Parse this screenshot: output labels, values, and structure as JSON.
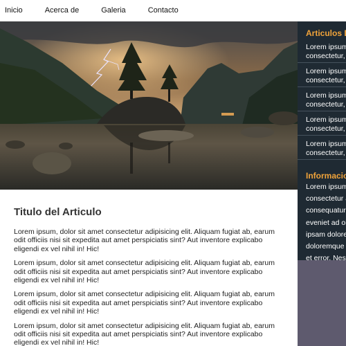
{
  "nav": {
    "items": [
      "Inicio",
      "Acerca de",
      "Galeria",
      "Contacto"
    ]
  },
  "hero": {
    "icon": "landscape-photo"
  },
  "article": {
    "title": "Titulo del Articulo",
    "paragraphs": [
      "Lorem ipsum, dolor sit amet consectetur adipisicing elit. Aliquam fugiat ab, earum odit officiis nisi sit expedita aut amet perspiciatis sint? Aut inventore explicabo eligendi ex vel nihil in! Hic!",
      "Lorem ipsum, dolor sit amet consectetur adipisicing elit. Aliquam fugiat ab, earum odit officiis nisi sit expedita aut amet perspiciatis sint? Aut inventore explicabo eligendi ex vel nihil in! Hic!",
      "Lorem ipsum, dolor sit amet consectetur adipisicing elit. Aliquam fugiat ab, earum odit officiis nisi sit expedita aut amet perspiciatis sint? Aut inventore explicabo eligendi ex vel nihil in! Hic!",
      "Lorem ipsum, dolor sit amet consectetur adipisicing elit. Aliquam fugiat ab, earum odit officiis nisi sit expedita aut amet perspiciatis sint? Aut inventore explicabo eligendi ex vel nihil in! Hic!"
    ]
  },
  "sidebar": {
    "articles_heading": "Articulos D",
    "articles": [
      {
        "line1": "Lorem ipsum",
        "line2": "consectetur, a"
      },
      {
        "line1": "Lorem ipsum",
        "line2": "consectetur, a"
      },
      {
        "line1": "Lorem ipsum",
        "line2": "consectetur, a"
      },
      {
        "line1": "Lorem ipsum",
        "line2": "consectetur, a"
      },
      {
        "line1": "Lorem ipsum",
        "line2": "consectetur, a"
      }
    ],
    "info_heading": "Informacio",
    "info_lines": [
      "Lorem ipsum",
      "consectetur a",
      "consequatur",
      "eveniet ad ob",
      "ipsam dolore",
      "doloremque s",
      "et error. Nesc"
    ]
  },
  "colors": {
    "accent": "#f0a33a",
    "sidebar_bg": "#1f2a33",
    "sidebar_footer": "#5e5a6e"
  }
}
